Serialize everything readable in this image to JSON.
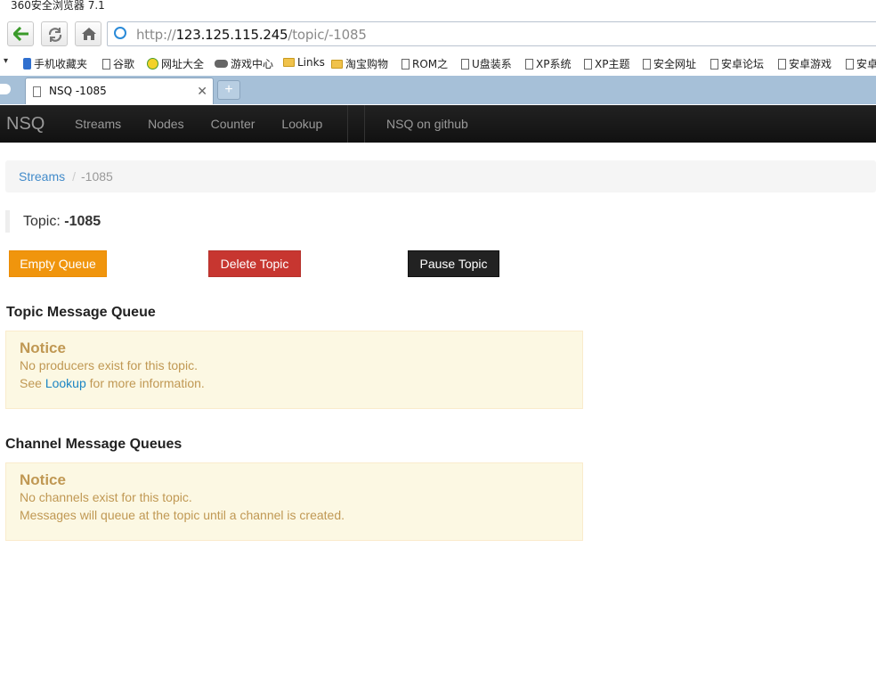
{
  "browser": {
    "title": "360安全浏览器 7.1",
    "url_prefix": "http://",
    "url_host": "123.125.115.245",
    "url_path": "/topic/-1085",
    "bookmarks": [
      "手机收藏夹",
      "谷歌",
      "网址大全",
      "游戏中心",
      "Links",
      "淘宝购物",
      "ROM之",
      "U盘装系",
      "XP系统",
      "XP主题",
      "安全网址",
      "安卓论坛",
      "安卓游戏",
      "安卓"
    ],
    "tab_title": "NSQ -1085",
    "tab_close": "✕",
    "new_tab": "+"
  },
  "navbar": {
    "brand": "NSQ",
    "links": [
      "Streams",
      "Nodes",
      "Counter",
      "Lookup"
    ],
    "github": "NSQ on github"
  },
  "breadcrumb": {
    "root": "Streams",
    "separator": "/",
    "current": "-1085"
  },
  "topic": {
    "label": "Topic: ",
    "name": "-1085"
  },
  "actions": {
    "empty_queue": "Empty Queue",
    "delete_topic": "Delete Topic",
    "pause_topic": "Pause Topic"
  },
  "topic_queue": {
    "heading": "Topic Message Queue",
    "notice_title": "Notice",
    "line1": "No producers exist for this topic.",
    "line2_prefix": "See ",
    "line2_link": "Lookup",
    "line2_suffix": " for more information."
  },
  "channel_queues": {
    "heading": "Channel Message Queues",
    "notice_title": "Notice",
    "line1": "No channels exist for this topic.",
    "line2": "Messages will queue at the topic until a channel is created."
  },
  "colors": {
    "warning": "#f0950d",
    "danger": "#c73630",
    "dark": "#222222",
    "link": "#428bca",
    "alert_text": "#c09853",
    "alert_bg": "#fcf8e3"
  }
}
